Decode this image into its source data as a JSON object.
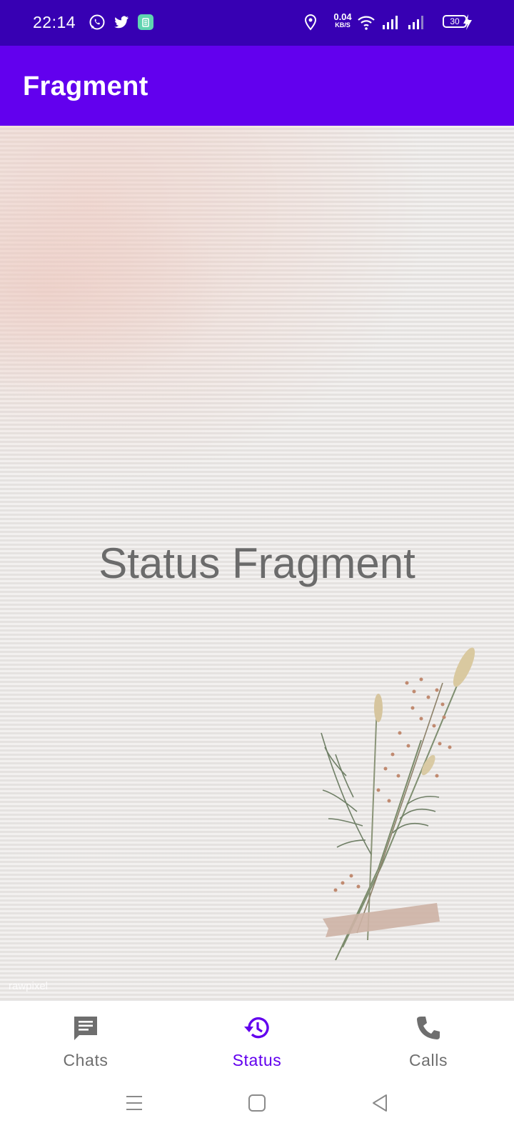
{
  "status_bar": {
    "time": "22:14",
    "net_speed": "0.04",
    "net_unit": "KB/S",
    "battery": "30",
    "icons": [
      "whatsapp-icon",
      "twitter-icon",
      "app-notification-icon",
      "location-icon",
      "wifi-icon",
      "signal-icon",
      "signal-icon",
      "battery-icon",
      "charging-icon"
    ]
  },
  "app_bar": {
    "title": "Fragment"
  },
  "content": {
    "text": "Status Fragment",
    "watermark": "rawpixel"
  },
  "bottom_nav": {
    "items": [
      {
        "label": "Chats",
        "icon": "chat-icon",
        "active": false
      },
      {
        "label": "Status",
        "icon": "history-icon",
        "active": true
      },
      {
        "label": "Calls",
        "icon": "phone-icon",
        "active": false
      }
    ]
  },
  "system_nav": {
    "buttons": [
      "menu-icon",
      "home-icon",
      "back-icon"
    ]
  },
  "colors": {
    "status_bar": "#3700B3",
    "app_bar": "#6200EE",
    "accent": "#6200EE",
    "inactive": "#6e6e6e"
  }
}
